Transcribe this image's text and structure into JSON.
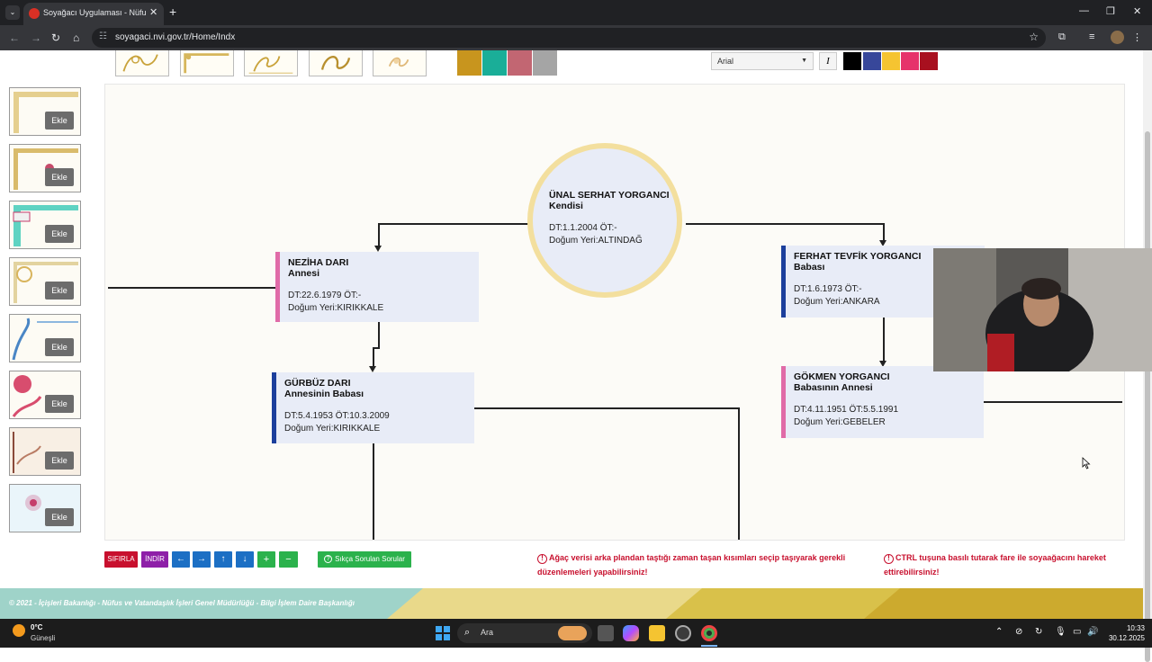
{
  "browser": {
    "tab_title": "Soyağacı Uygulaması - Nüfus ve",
    "url": "soyagaci.nvi.gov.tr/Home/Indx"
  },
  "toolbar": {
    "font_value": "Arial",
    "italic_label": "I",
    "bg_colors": [
      "#c8951e",
      "#1aae98",
      "#c26672",
      "#a5a5a5"
    ],
    "text_colors": [
      "#000000",
      "#37479a",
      "#f5c431",
      "#e6336b",
      "#a8101f"
    ]
  },
  "sidebar": {
    "add_label": "Ekle"
  },
  "tree": {
    "self": {
      "name": "ÜNAL SERHAT YORGANCI",
      "role": "Kendisi",
      "dates": "DT:1.1.2004 ÖT:-",
      "place": "Doğum Yeri:ALTINDAĞ"
    },
    "mother": {
      "name": "NEZİHA DARI",
      "role": "Annesi",
      "dates": "DT:22.6.1979 ÖT:-",
      "place": "Doğum Yeri:KIRIKKALE"
    },
    "father": {
      "name": "FERHAT TEVFİK YORGANCI",
      "role": "Babası",
      "dates": "DT:1.6.1973 ÖT:-",
      "place": "Doğum Yeri:ANKARA"
    },
    "mothers_father": {
      "name": "GÜRBÜZ DARI",
      "role": "Annesinin Babası",
      "dates": "DT:5.4.1953 ÖT:10.3.2009",
      "place": "Doğum Yeri:KIRIKKALE"
    },
    "fathers_mother": {
      "name": "GÖKMEN YORGANCI",
      "role": "Babasının Annesi",
      "dates": "DT:4.11.1951 ÖT:5.5.1991",
      "place": "Doğum Yeri:GEBELER"
    }
  },
  "controls": {
    "reset": "SIFIRLA",
    "download": "İNDİR",
    "left": "←",
    "right": "→",
    "up": "↑",
    "down": "↓",
    "zoom_in": "+",
    "zoom_out": "−",
    "faq": "Sıkça Sorulan Sorular"
  },
  "warnings": {
    "w1": "Ağaç verisi arka plandan taştığı zaman taşan kısımları seçip taşıyarak gerekli düzenlemeleri yapabilirsiniz!",
    "w2": "CTRL tuşuna basılı tutarak fare ile soyaağacını hareket ettirebilirsiniz!"
  },
  "footer": {
    "text": "© 2021 - İçişleri Bakanlığı - Nüfus ve Vatandaşlık İşleri Genel Müdürlüğü - Bilgi İşlem Daire Başkanlığı"
  },
  "taskbar": {
    "temp": "0°C",
    "condition": "Güneşli",
    "search_placeholder": "Ara",
    "time": "10:33",
    "date": "30.12.2025"
  }
}
